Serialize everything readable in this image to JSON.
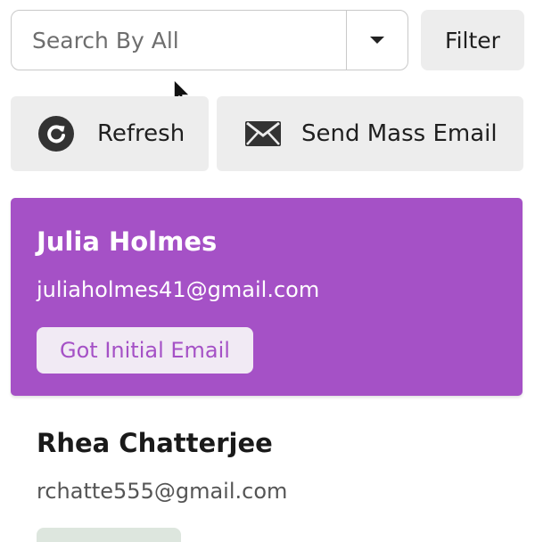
{
  "search": {
    "placeholder": "Search By All",
    "dropdown_icon": "caret-down-icon"
  },
  "toolbar": {
    "filter_label": "Filter",
    "refresh_label": "Refresh",
    "refresh_icon": "refresh-icon",
    "mass_email_label": "Send Mass Email",
    "mass_email_icon": "envelope-icon"
  },
  "contacts": [
    {
      "name": "Julia Holmes",
      "email": "juliaholmes41@gmail.com",
      "status": "Got Initial Email",
      "selected": true
    },
    {
      "name": "Rhea Chatterjee",
      "email": "rchatte555@gmail.com",
      "selected": false
    }
  ],
  "colors": {
    "accent": "#a551c6",
    "button_bg": "#ededed",
    "badge_bg": "#f1eaf4",
    "second_badge_bg": "#dde6de"
  }
}
